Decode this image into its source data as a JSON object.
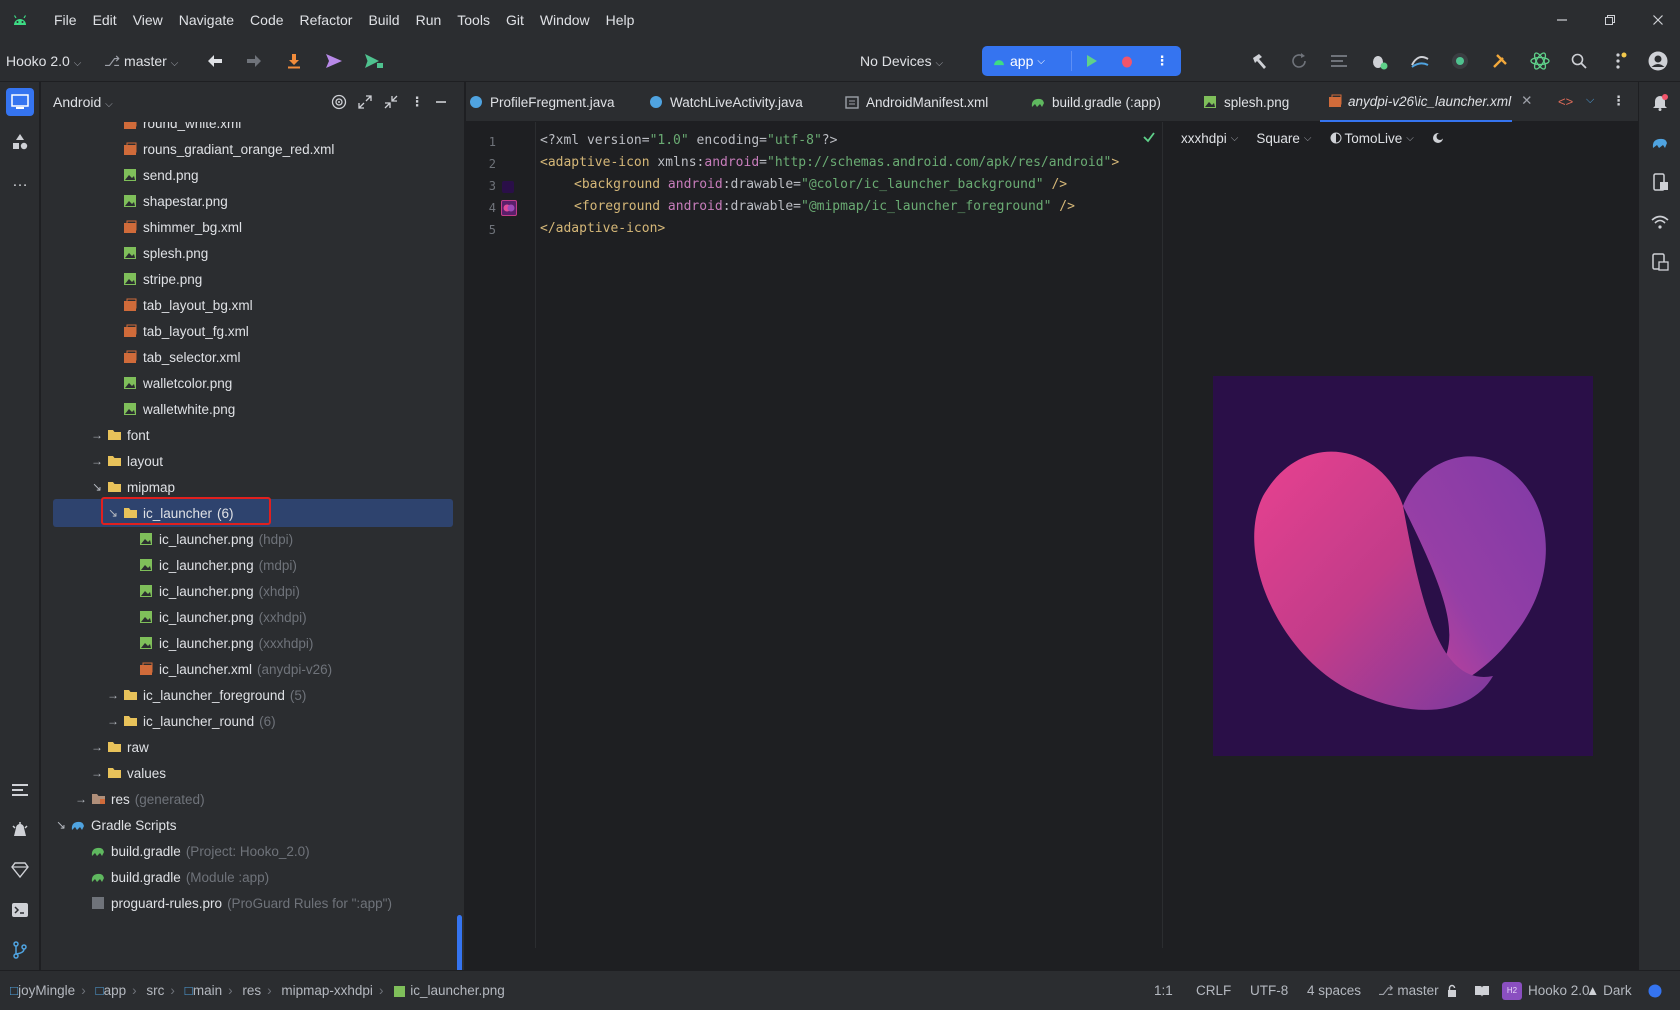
{
  "menubar": {
    "items": [
      "File",
      "Edit",
      "View",
      "Navigate",
      "Code",
      "Refactor",
      "Build",
      "Run",
      "Tools",
      "Git",
      "Window",
      "Help"
    ]
  },
  "toolbar": {
    "project_name": "Hooko 2.0",
    "branch": "master",
    "device": "No Devices",
    "run_config": "app"
  },
  "project_panel": {
    "title": "Android",
    "rows": [
      {
        "label": "round_white.xml",
        "hint": "",
        "type": "xml"
      },
      {
        "label": "rouns_gradiant_orange_red.xml",
        "hint": "",
        "type": "xml"
      },
      {
        "label": "send.png",
        "hint": "",
        "type": "png"
      },
      {
        "label": "shapestar.png",
        "hint": "",
        "type": "png"
      },
      {
        "label": "shimmer_bg.xml",
        "hint": "",
        "type": "xml"
      },
      {
        "label": "splesh.png",
        "hint": "",
        "type": "png"
      },
      {
        "label": "stripe.png",
        "hint": "",
        "type": "png"
      },
      {
        "label": "tab_layout_bg.xml",
        "hint": "",
        "type": "xml"
      },
      {
        "label": "tab_layout_fg.xml",
        "hint": "",
        "type": "xml"
      },
      {
        "label": "tab_selector.xml",
        "hint": "",
        "type": "xml"
      },
      {
        "label": "walletcolor.png",
        "hint": "",
        "type": "png"
      },
      {
        "label": "walletwhite.png",
        "hint": "",
        "type": "png"
      },
      {
        "label": "font",
        "hint": "",
        "type": "folder"
      },
      {
        "label": "layout",
        "hint": "",
        "type": "folder"
      },
      {
        "label": "mipmap",
        "hint": "",
        "type": "folder"
      },
      {
        "label": "ic_launcher",
        "hint": "(6)",
        "type": "folder"
      },
      {
        "label": "ic_launcher.png",
        "hint": "(hdpi)",
        "type": "png"
      },
      {
        "label": "ic_launcher.png",
        "hint": "(mdpi)",
        "type": "png"
      },
      {
        "label": "ic_launcher.png",
        "hint": "(xhdpi)",
        "type": "png"
      },
      {
        "label": "ic_launcher.png",
        "hint": "(xxhdpi)",
        "type": "png"
      },
      {
        "label": "ic_launcher.png",
        "hint": "(xxxhdpi)",
        "type": "png"
      },
      {
        "label": "ic_launcher.xml",
        "hint": "(anydpi-v26)",
        "type": "xml"
      },
      {
        "label": "ic_launcher_foreground",
        "hint": "(5)",
        "type": "folder"
      },
      {
        "label": "ic_launcher_round",
        "hint": "(6)",
        "type": "folder"
      },
      {
        "label": "raw",
        "hint": "",
        "type": "folder"
      },
      {
        "label": "values",
        "hint": "",
        "type": "folder"
      },
      {
        "label": "res",
        "hint": "(generated)",
        "type": "folder-res"
      },
      {
        "label": "Gradle Scripts",
        "hint": "",
        "type": "gradle-root"
      },
      {
        "label": "build.gradle",
        "hint": "(Project: Hooko_2.0)",
        "type": "gradle"
      },
      {
        "label": "build.gradle",
        "hint": "(Module :app)",
        "type": "gradle"
      },
      {
        "label": "proguard-rules.pro",
        "hint": "(ProGuard Rules for \":app\")",
        "type": "pro"
      }
    ]
  },
  "tabs": [
    {
      "label": "ProfileFregment.java"
    },
    {
      "label": "WatchLiveActivity.java"
    },
    {
      "label": "AndroidManifest.xml"
    },
    {
      "label": "build.gradle (:app)"
    },
    {
      "label": "splesh.png"
    },
    {
      "label": "anydpi-v26\\ic_launcher.xml"
    }
  ],
  "editor": {
    "line_numbers": [
      "1",
      "2",
      "3",
      "4",
      "5"
    ],
    "line1": {
      "a": "<?xml version=",
      "b": "\"1.0\"",
      "c": " encoding=",
      "d": "\"utf-8\"",
      "e": "?>"
    },
    "line2": {
      "a": "<adaptive-icon ",
      "b": "xmlns:",
      "c": "android",
      "d": "=",
      "e": "\"http://schemas.android.com/apk/res/android\"",
      "f": ">"
    },
    "line3": {
      "a": "<background ",
      "b": "android",
      "c": ":drawable=",
      "d": "\"@color/ic_launcher_background\"",
      "e": " />"
    },
    "line4": {
      "a": "<foreground ",
      "b": "android",
      "c": ":drawable=",
      "d": "\"@mipmap/ic_launcher_foreground\"",
      "e": " />"
    },
    "line5": {
      "a": "</adaptive-icon>"
    }
  },
  "preview": {
    "density": "xxxhdpi",
    "shape": "Square",
    "theme": "TomoLive",
    "background_color": "#2a0f48"
  },
  "statusbar": {
    "breadcrumbs": [
      "joyMingle",
      "app",
      "src",
      "main",
      "res",
      "mipmap-xxhdpi",
      "ic_launcher.png"
    ],
    "position": "1:1",
    "line_sep": "CRLF",
    "encoding": "UTF-8",
    "indent": "4 spaces",
    "branch": "master",
    "project": "Hooko 2.0",
    "project_badge": "H2",
    "theme": "Dark"
  },
  "colors": {
    "accent": "#3574f0",
    "selection": "#2e436e",
    "highlight_box": "#e0201e"
  }
}
